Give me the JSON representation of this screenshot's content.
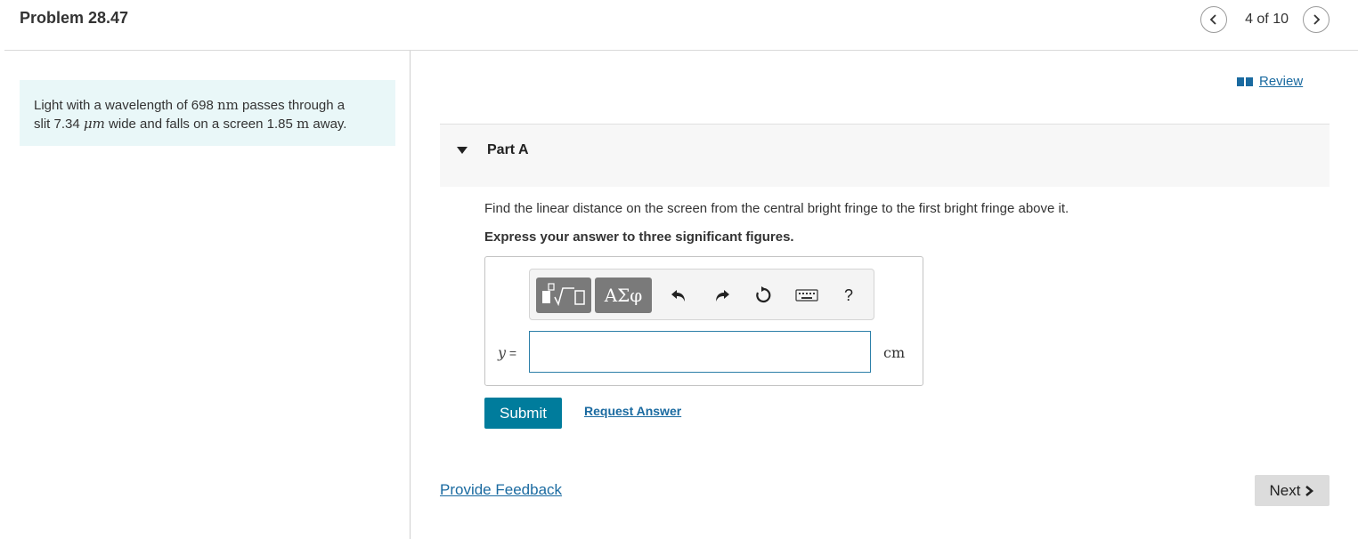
{
  "header": {
    "title": "Problem 28.47",
    "page_indicator": "4 of 10",
    "prev_icon": "chevron-left-icon",
    "next_icon": "chevron-right-icon"
  },
  "problem": {
    "text_1": "Light with a wavelength of 698 ",
    "unit_nm": "nm",
    "text_2": " passes through a",
    "text_3": "slit 7.34 ",
    "unit_um": "μm",
    "text_4": " wide and falls on a screen 1.85 ",
    "unit_m": "m",
    "text_5": " away."
  },
  "review": {
    "label": "Review",
    "icon": "book-icon"
  },
  "part": {
    "label": "Part A",
    "question": "Find the linear distance on the screen from the central bright fringe to the first bright fringe above it.",
    "instruction": "Express your answer to three significant figures."
  },
  "toolbar": {
    "greek_label": "ΑΣφ",
    "help_label": "?",
    "icons": [
      "templates-icon",
      "greek-symbols-icon",
      "undo-icon",
      "redo-icon",
      "reset-icon",
      "keyboard-icon",
      "help-icon"
    ]
  },
  "answer": {
    "variable": "y",
    "equals": " =",
    "value": "",
    "unit": "cm"
  },
  "actions": {
    "submit_label": "Submit",
    "request_label": "Request Answer",
    "feedback_label": "Provide Feedback",
    "next_label": "Next"
  },
  "colors": {
    "accent": "#007c9c",
    "link": "#1a6aa0",
    "problem_bg": "#e9f7f8"
  }
}
